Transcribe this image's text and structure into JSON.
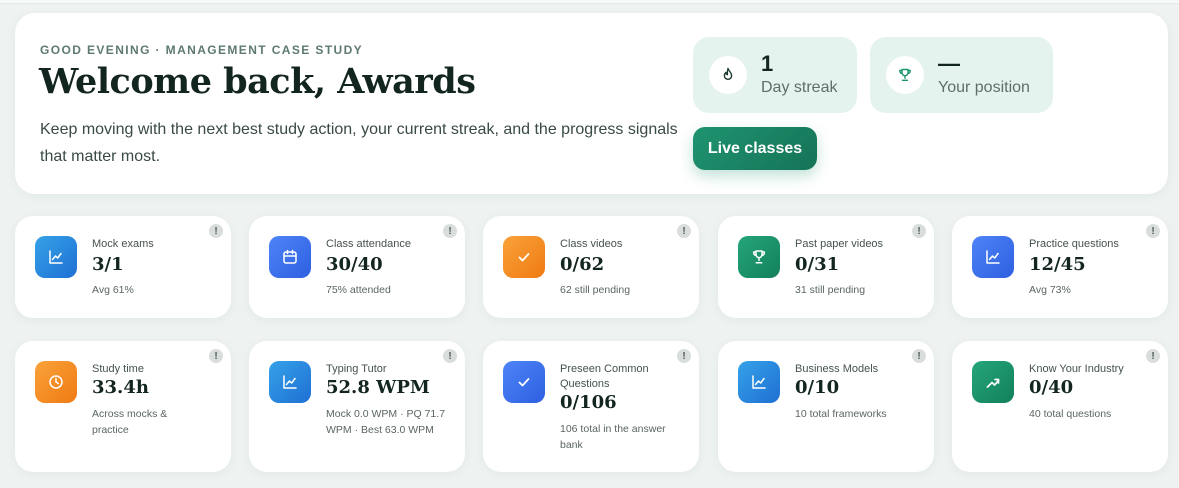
{
  "hero": {
    "eyebrow": "GOOD EVENING · MANAGEMENT CASE STUDY",
    "title": "Welcome back, Awards",
    "subtitle": "Keep moving with the next best study action, your current streak, and the progress signals that matter most.",
    "streak": {
      "value": "1",
      "label": "Day streak",
      "icon": "flame-icon"
    },
    "position": {
      "value": "—",
      "label": "Your position",
      "icon": "trophy-icon"
    },
    "live_button": "Live classes"
  },
  "cards": [
    {
      "title": "Mock exams",
      "value": "3/1",
      "note": "Avg 61%",
      "icon": "chart-line-icon",
      "color": "#2a88e0"
    },
    {
      "title": "Class attendance",
      "value": "30/40",
      "note": "75% attended",
      "icon": "calendar-icon",
      "color": "#3b6ef0"
    },
    {
      "title": "Class videos",
      "value": "0/62",
      "note": "62 still pending",
      "icon": "check-icon",
      "color": "#f48a22"
    },
    {
      "title": "Past paper videos",
      "value": "0/31",
      "note": "31 still pending",
      "icon": "trophy-icon",
      "color": "#1a9469"
    },
    {
      "title": "Practice questions",
      "value": "12/45",
      "note": "Avg 73%",
      "icon": "chart-line-icon",
      "color": "#3b6ef0"
    },
    {
      "title": "Study time",
      "value": "33.4h",
      "note": "Across mocks & practice",
      "icon": "clock-icon",
      "color": "#f48a22"
    },
    {
      "title": "Typing Tutor",
      "value": "52.8 WPM",
      "note": "Mock 0.0 WPM · PQ 71.7 WPM · Best 63.0 WPM",
      "icon": "chart-line-icon",
      "color": "#2a88e0"
    },
    {
      "title": "Preseen Common Questions",
      "value": "0/106",
      "note": "106 total in the answer bank",
      "icon": "check-icon",
      "color": "#3b6ef0"
    },
    {
      "title": "Business Models",
      "value": "0/10",
      "note": "10 total frameworks",
      "icon": "chart-line-icon",
      "color": "#2a88e0"
    },
    {
      "title": "Know Your Industry",
      "value": "0/40",
      "note": "40 total questions",
      "icon": "trend-up-icon",
      "color": "#1a9469"
    }
  ],
  "info_glyph": "!"
}
